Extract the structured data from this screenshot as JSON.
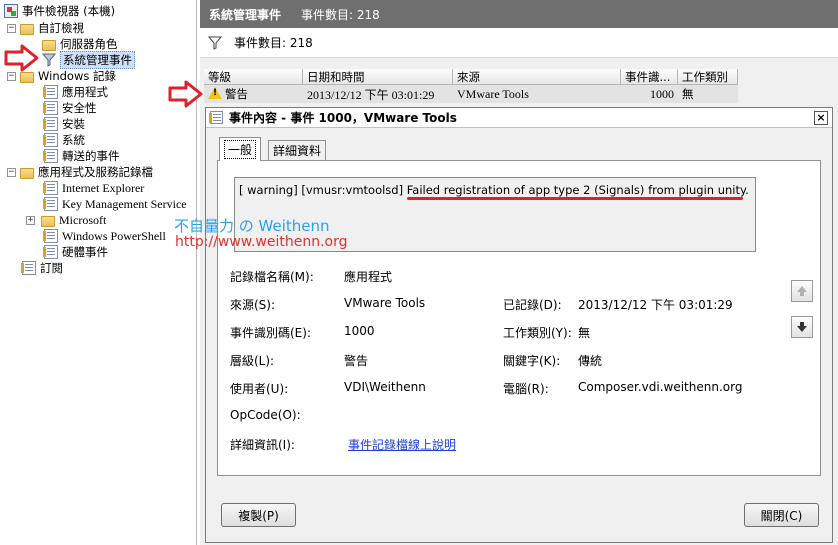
{
  "tree": {
    "root": "事件檢視器 (本機)",
    "custom_views": "自訂檢視",
    "server_roles": "伺服器角色",
    "admin_events": "系統管理事件",
    "windows_logs": "Windows 記錄",
    "application": "應用程式",
    "security": "安全性",
    "setup": "安裝",
    "system": "系統",
    "forwarded": "轉送的事件",
    "apps_services": "應用程式及服務記錄檔",
    "ie": "Internet Explorer",
    "kms": "Key Management Service",
    "microsoft": "Microsoft",
    "powershell": "Windows PowerShell",
    "hardware": "硬體事件",
    "subscriptions": "訂閱"
  },
  "pane": {
    "title": "系統管理事件",
    "count_label": "事件數目: 218",
    "filter_text": "事件數目: 218"
  },
  "grid": {
    "headers": [
      "等級",
      "日期和時間",
      "來源",
      "事件識...",
      "工作類別"
    ],
    "row": {
      "level": "警告",
      "datetime": "2013/12/12 下午 03:01:29",
      "source": "VMware Tools",
      "event_id": "1000",
      "task": "無"
    }
  },
  "dialog": {
    "title": "事件內容 - 事件 1000，VMware Tools",
    "tabs": [
      "一般",
      "詳細資料"
    ],
    "description": "[ warning] [vmusr:vmtoolsd] Failed registration of app type 2 (Signals) from plugin unity.",
    "fields": {
      "log_name_label": "記錄檔名稱(M):",
      "log_name": "應用程式",
      "source_label": "來源(S):",
      "source": "VMware Tools",
      "logged_label": "已記錄(D):",
      "logged": "2013/12/12 下午 03:01:29",
      "event_id_label": "事件識別碼(E):",
      "event_id": "1000",
      "task_label": "工作類別(Y):",
      "task": "無",
      "level_label": "層級(L):",
      "level": "警告",
      "keywords_label": "關鍵字(K):",
      "keywords": "傳統",
      "user_label": "使用者(U):",
      "user": "VDI\\Weithenn",
      "computer_label": "電腦(R):",
      "computer": "Composer.vdi.weithenn.org",
      "opcode_label": "OpCode(O):",
      "more_info_label": "詳細資訊(I):",
      "more_info_link": "事件記錄檔線上說明"
    },
    "copy_button": "複製(P)",
    "close_button": "關閉(C)"
  },
  "watermark": {
    "line1": "不自量力 の Weithenn",
    "line2": "http://www.weithenn.org"
  },
  "colors": {
    "accent_red": "#e0202a",
    "watermark_blue": "#2aa2e8",
    "header_gray": "#6f6f6f"
  }
}
